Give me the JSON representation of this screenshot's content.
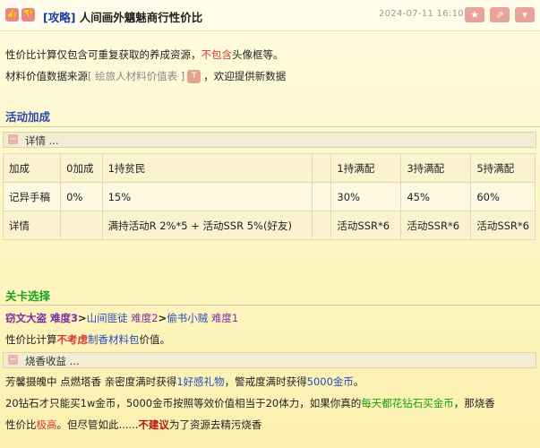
{
  "header": {
    "title_tag": "[攻略]",
    "title_text": " 人间画外魑魅商行性价比",
    "date": "2024-07-11 16:10",
    "vote_up": "👍",
    "vote_down": "👎",
    "star_icon": "★",
    "share_icon": "⇗",
    "more_icon": "▾"
  },
  "intro": {
    "line1_a": "性价比计算仅包含可重复获取的养成资源，",
    "line1_red": "不包含",
    "line1_b": "头像框等。",
    "line2_a": "材料价值数据来源",
    "line2_source": "[ 绘旅人材料价值表 ]",
    "line2_t": "T",
    "line2_b": "，欢迎提供新数据"
  },
  "section1": {
    "title": "活动加成",
    "fold_label": "详情 ...",
    "table": [
      [
        "加成",
        "0加成",
        "1持贫民",
        "",
        "1持满配",
        "3持满配",
        "5持满配"
      ],
      [
        "记异手稿",
        "0%",
        "15%",
        "",
        "30%",
        "45%",
        "60%"
      ],
      [
        "详情",
        "",
        "满持活动R 2%*5 + 活动SSR 5%(好友)",
        "",
        "活动SSR*6",
        "活动SSR*6",
        "活动SSR*6"
      ]
    ]
  },
  "section2": {
    "title": "关卡选择",
    "stage_line": {
      "a": "窃文大盗 难度3",
      "arrow1": ">",
      "b": "山间匪徒",
      "c": " 难度2",
      "arrow2": ">",
      "d": "偷书小贼",
      "e": " 难度1"
    },
    "calc_line": {
      "a": "性价比计算",
      "red": "不考虑",
      "b": "制香材料包",
      "c": "价值。"
    },
    "fold_label": "烧香收益 ...",
    "p1": {
      "a": "芳馨摄魄中 点燃塔香 亲密度满时获得",
      "b": "1好感礼物",
      "c": "，警戒度满时获得",
      "d": "5000金币",
      "e": "。"
    },
    "p2": {
      "a": "20钻石才只能买1w金币，5000金币按照等效价值相当于20体力，如果你真的",
      "b": "每天都花钻石买金币",
      "c": "，那烧香"
    },
    "p3": {
      "a": "性价比",
      "b": "极高",
      "c": "。但尽管如此......",
      "d": "不建议",
      "e": "为了资源去精污烧香"
    }
  }
}
